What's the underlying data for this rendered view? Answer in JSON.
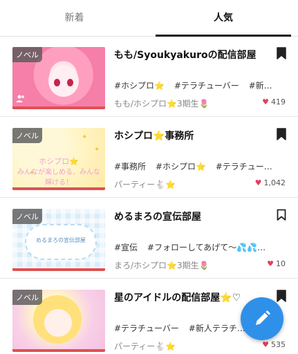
{
  "tabs": [
    {
      "label": "新着",
      "active": false
    },
    {
      "label": "人気",
      "active": true
    }
  ],
  "badge_label": "ノベル",
  "rooms": [
    {
      "title": "もも/Syoukyakuroの配信部屋",
      "tags": [
        "#ホシプロ⭐",
        "#テラチューバー",
        "#新…"
      ],
      "meta": "もも/ホシプロ⭐3期生🌷",
      "likes": "419",
      "bookmarked": true,
      "thumbnail_icon": "group-icon"
    },
    {
      "title": "ホシプロ⭐事務所",
      "tags": [
        "#事務所",
        "#ホシプロ⭐",
        "#テラチュー…"
      ],
      "meta": "パーティー🐇⭐",
      "likes": "1,042",
      "bookmarked": true,
      "thumbnail_text": [
        "ホシプロ⭐",
        "みんなが楽しめる、みんな",
        "輝ける！"
      ]
    },
    {
      "title": "めるまろの宣伝部屋",
      "tags": [
        "#宣伝",
        "#フォローしてあげて〜💦💦…"
      ],
      "meta": "まろ/ホシプロ⭐3期生🌷",
      "likes": "10",
      "bookmarked": false,
      "thumbnail_text": "めるまろの宣伝部屋"
    },
    {
      "title": "星のアイドルの配信部屋⭐♡",
      "tags": [
        "#テラチューバー",
        "#新人テラチ…"
      ],
      "meta": "パーティー🐇⭐",
      "likes": "535",
      "bookmarked": true
    }
  ],
  "fab_icon": "pencil-icon",
  "colors": {
    "accent": "#2f90ea",
    "heart": "#e0405a",
    "progress": "#e05050"
  }
}
